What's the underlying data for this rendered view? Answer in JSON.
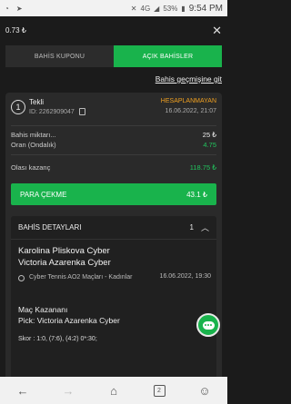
{
  "statusbar": {
    "network": "4G",
    "battery": "53%",
    "time": "9:54 PM"
  },
  "topbar": {
    "balance": "0.73 ₺",
    "close_icon": "close-icon"
  },
  "tabs": [
    {
      "label": "BAHİS KUPONU",
      "active": false
    },
    {
      "label": "AÇIK BAHİSLER",
      "active": true
    }
  ],
  "history_link": "Bahis geçmişine git",
  "bet": {
    "number": "1",
    "type": "Tekli",
    "id": "ID: 2262909047",
    "status": "HESAPLANMAYAN",
    "date": "16.06.2022, 21:07",
    "stake_label": "Bahis miktarı...",
    "stake_value": "25 ₺",
    "odds_label": "Oran (Ondalık)",
    "odds_value": "4.75",
    "potential_label": "Olası kazanç",
    "potential_value": "118.75 ₺",
    "cashout_label": "PARA ÇEKME",
    "cashout_value": "43.1 ₺"
  },
  "details": {
    "title": "BAHİS DETAYLARI",
    "count": "1",
    "team1": "Karolina Pliskova Cyber",
    "team2": "Victoria Azarenka Cyber",
    "league": "Cyber Tennis AO2 Maçları - Kadınlar",
    "match_date": "16.06.2022, 19:30",
    "market": "Maç Kazananı",
    "pick": "Pick: Victoria Azarenka Cyber",
    "odd_partial": "4",
    "score": "Skor : 1:0, (7:6), (4:2) 0*:30;"
  },
  "navbar": {
    "tab_count": "2"
  },
  "colors": {
    "accent": "#19b34c",
    "status_pending": "#f0a020",
    "positive": "#22c55e",
    "background": "#1b1b1b",
    "card": "#2a2a2a"
  }
}
